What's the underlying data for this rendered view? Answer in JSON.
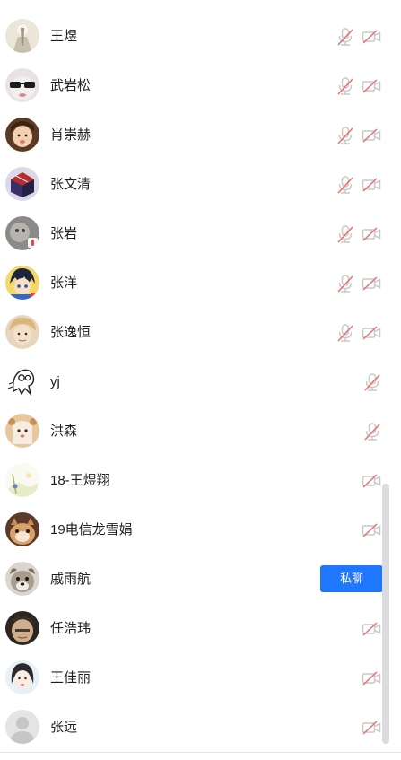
{
  "colors": {
    "accent": "#1f76ff",
    "muted_icon": "#c9c9c9",
    "slash": "#f06b6b"
  },
  "members": [
    {
      "name": "王煜",
      "mic": "muted",
      "camera": "off"
    },
    {
      "name": "武岩松",
      "mic": "muted",
      "camera": "off"
    },
    {
      "name": "肖崇赫",
      "mic": "muted",
      "camera": "off"
    },
    {
      "name": "张文清",
      "mic": "muted",
      "camera": "off"
    },
    {
      "name": "张岩",
      "mic": "muted",
      "camera": "off"
    },
    {
      "name": "张洋",
      "mic": "muted",
      "camera": "off"
    },
    {
      "name": "张逸恒",
      "mic": "muted",
      "camera": "off"
    },
    {
      "name": "yj",
      "mic": "muted",
      "camera": "none"
    },
    {
      "name": "洪森",
      "mic": "muted",
      "camera": "none"
    },
    {
      "name": "18-王煜翔",
      "mic": "none",
      "camera": "off"
    },
    {
      "name": "19电信龙雪娟",
      "mic": "none",
      "camera": "off"
    },
    {
      "name": "戚雨航",
      "mic": "none",
      "camera": "none",
      "action": "私聊"
    },
    {
      "name": "任浩玮",
      "mic": "none",
      "camera": "off"
    },
    {
      "name": "王佳丽",
      "mic": "none",
      "camera": "off"
    },
    {
      "name": "张远",
      "mic": "none",
      "camera": "off"
    }
  ]
}
